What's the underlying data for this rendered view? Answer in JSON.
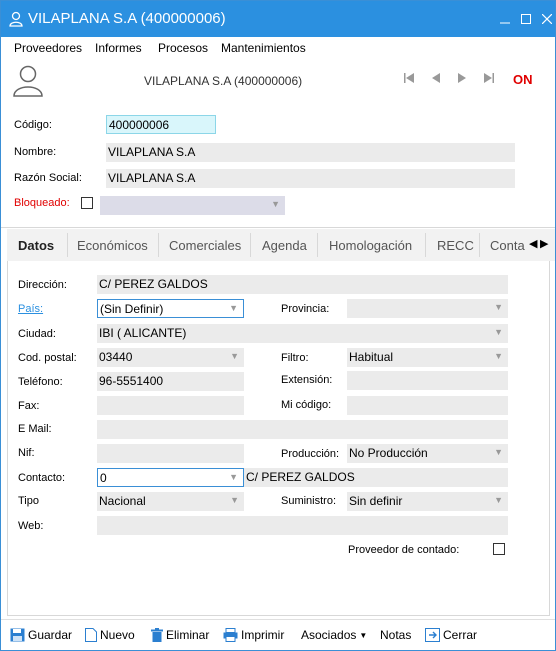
{
  "window": {
    "title": "VILAPLANA S.A (400000006)",
    "accent": "#2b90e0"
  },
  "menu": [
    "Proveedores",
    "Informes",
    "Procesos",
    "Mantenimientos"
  ],
  "header": {
    "title": "VILAPLANA S.A (400000006)",
    "status": "ON",
    "status_color": "#e00000"
  },
  "general": {
    "codigo_label": "Código:",
    "codigo_value": "400000006",
    "nombre_label": "Nombre:",
    "nombre_value": "VILAPLANA S.A",
    "razon_label": "Razón Social:",
    "razon_value": "VILAPLANA S.A",
    "bloqueado_label": "Bloqueado:",
    "bloqueado_checked": false,
    "bloqueado_select": ""
  },
  "tabs": [
    "Datos",
    "Económicos",
    "Comerciales",
    "Agenda",
    "Homologación",
    "RECC",
    "Conta"
  ],
  "active_tab": "Datos",
  "datos": {
    "direccion_label": "Dirección:",
    "direccion_value": "C/ PEREZ GALDOS",
    "pais_label": "País:",
    "pais_value": "(Sin Definir)",
    "provincia_label": "Provincia:",
    "provincia_value": "",
    "ciudad_label": "Ciudad:",
    "ciudad_value": "IBI ( ALICANTE)",
    "cp_label": "Cod. postal:",
    "cp_value": "03440",
    "filtro_label": "Filtro:",
    "filtro_value": "Habitual",
    "telefono_label": "Teléfono:",
    "telefono_value": "96-5551400",
    "extension_label": "Extensión:",
    "extension_value": "",
    "fax_label": "Fax:",
    "fax_value": "",
    "micodigo_label": "Mi código:",
    "micodigo_value": "",
    "email_label": "E Mail:",
    "email_value": "",
    "nif_label": "Nif:",
    "nif_value": "",
    "produccion_label": "Producción:",
    "produccion_value": "No Producción",
    "contacto_label": "Contacto:",
    "contacto_value": "0",
    "contacto_desc": "C/ PEREZ GALDOS",
    "tipo_label": "Tipo",
    "tipo_value": "Nacional",
    "suministro_label": "Suministro:",
    "suministro_value": "Sin definir",
    "web_label": "Web:",
    "web_value": "",
    "contado_label": "Proveedor de contado:",
    "contado_checked": false
  },
  "toolbar": {
    "guardar": "Guardar",
    "nuevo": "Nuevo",
    "eliminar": "Eliminar",
    "imprimir": "Imprimir",
    "asociados": "Asociados",
    "notas": "Notas",
    "cerrar": "Cerrar"
  }
}
